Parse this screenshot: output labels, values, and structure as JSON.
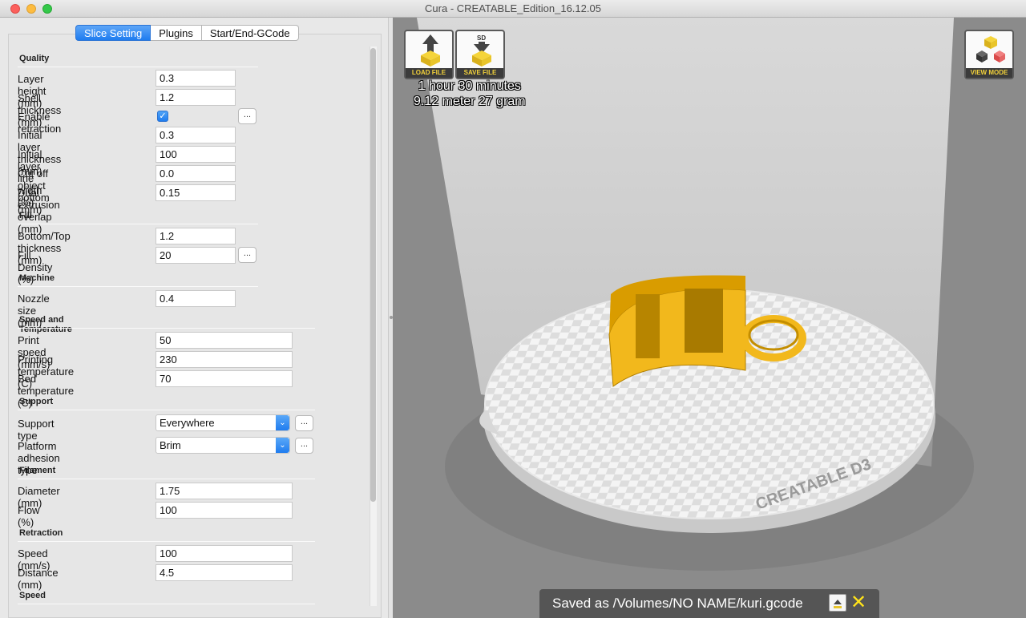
{
  "window": {
    "title": "Cura - CREATABLE_Edition_16.12.05"
  },
  "tabs": [
    "Slice Setting",
    "Plugins",
    "Start/End-GCode"
  ],
  "settings": {
    "quality": {
      "header": "Quality",
      "layer_height_label": "Layer height (mm)",
      "layer_height": "0.3",
      "shell_label": "Shell thickness (mm)",
      "shell": "1.2",
      "retraction_label": "Enable retraction",
      "retraction_checked": true,
      "initial_layer_label": "Initial layer thickness (mm)",
      "initial_layer": "0.3",
      "line_width_label": "Initial layer line width (%)",
      "line_width": "100",
      "cut_off_label": "Cut off object bottom (mm)",
      "cut_off": "0.0",
      "dual_overlap_label": "Dual extrusion overlap (mm)",
      "dual_overlap": "0.15"
    },
    "fill": {
      "header": "Fill",
      "bottom_top_label": "Bottom/Top thickness (mm)",
      "bottom_top": "1.2",
      "density_label": "Fill Density (%)",
      "density": "20"
    },
    "machine": {
      "header": "Machine",
      "nozzle_label": "Nozzle size (mm)",
      "nozzle": "0.4"
    },
    "speed_temp": {
      "header": "Speed and Temperature",
      "print_speed_label": "Print speed (mm/s)",
      "print_speed": "50",
      "print_temp_label": "Printing temperature (C)",
      "print_temp": "230",
      "bed_temp_label": "Bed temperature (C)",
      "bed_temp": "70"
    },
    "support": {
      "header": "Support",
      "type_label": "Support type",
      "type": "Everywhere",
      "adhesion_label": "Platform adhesion type",
      "adhesion": "Brim"
    },
    "filament": {
      "header": "Filament",
      "diameter_label": "Diameter (mm)",
      "diameter": "1.75",
      "flow_label": "Flow (%)",
      "flow": "100"
    },
    "retraction": {
      "header": "Retraction",
      "speed_label": "Speed (mm/s)",
      "speed": "100",
      "distance_label": "Distance (mm)",
      "distance": "4.5"
    },
    "speed": {
      "header": "Speed"
    },
    "dots_label": "..."
  },
  "viewport": {
    "load_file": "LOAD FILE",
    "save_file": "SAVE FILE",
    "sd_label": "SD",
    "view_mode": "VIEW MODE",
    "print_time": "1 hour 30 minutes",
    "print_material": "9.12 meter 27 gram",
    "bed_brand": "CREATABLE D3",
    "status": "Saved as /Volumes/NO NAME/kuri.gcode"
  },
  "colors": {
    "accent": "#1f7cef",
    "model": "#f2b81c",
    "viewport_bg": "#8b8b8b"
  }
}
